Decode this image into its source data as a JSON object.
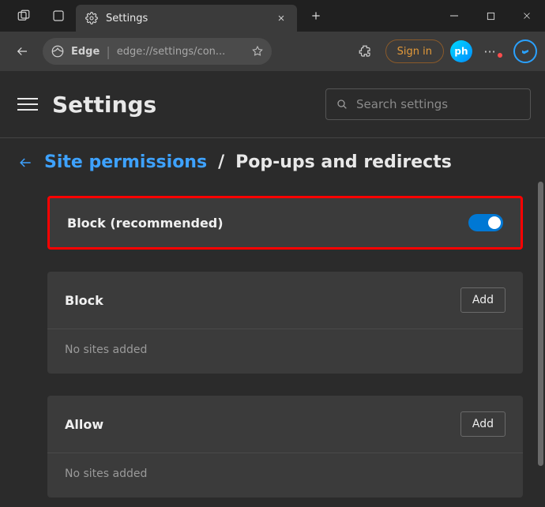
{
  "titlebar": {
    "tab_title": "Settings"
  },
  "toolbar": {
    "edge_label": "Edge",
    "url": "edge://settings/con...",
    "signin": "Sign in"
  },
  "header": {
    "title": "Settings",
    "search_placeholder": "Search settings"
  },
  "breadcrumb": {
    "parent": "Site permissions",
    "sep": "/",
    "current": "Pop-ups and redirects"
  },
  "main": {
    "block_toggle_label": "Block (recommended)",
    "block_section": {
      "title": "Block",
      "add": "Add",
      "empty": "No sites added"
    },
    "allow_section": {
      "title": "Allow",
      "add": "Add",
      "empty": "No sites added"
    }
  }
}
